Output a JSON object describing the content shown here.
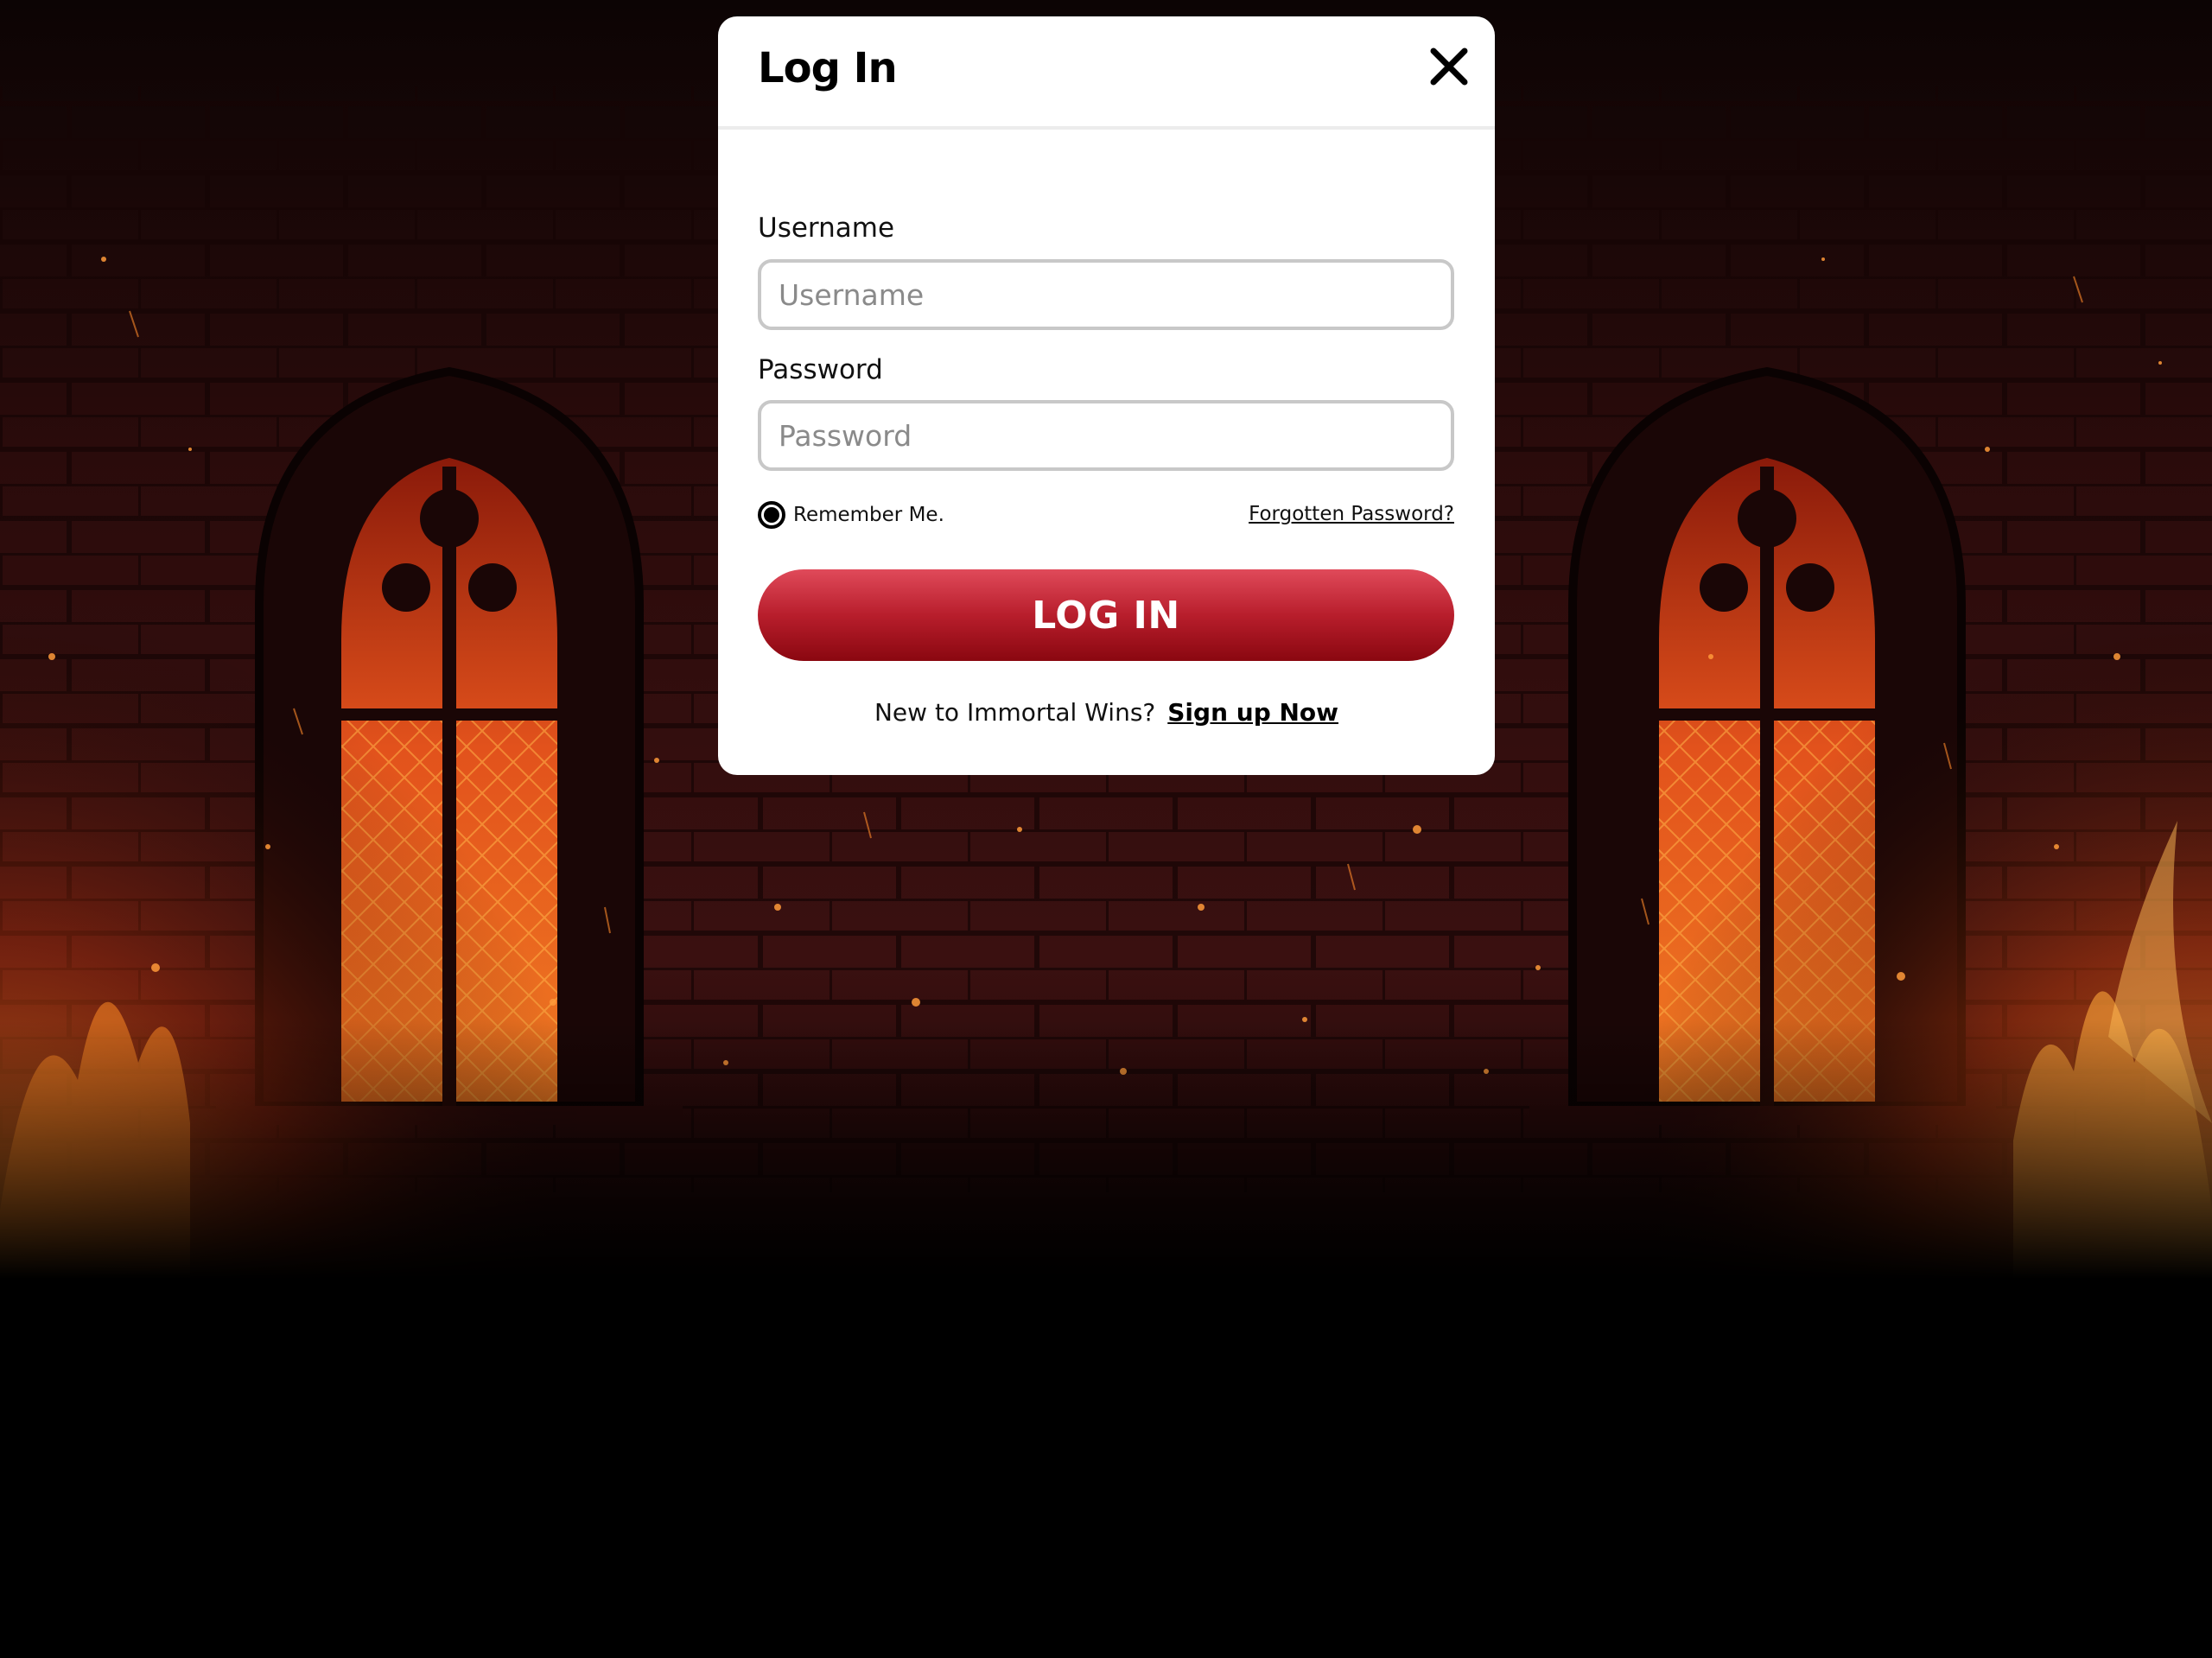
{
  "modal": {
    "title": "Log In"
  },
  "form": {
    "username_label": "Username",
    "username_placeholder": "Username",
    "username_value": "",
    "password_label": "Password",
    "password_placeholder": "Password",
    "password_value": "",
    "remember_label": "Remember Me.",
    "remember_checked": true,
    "forgot_label": "Forgotten Password?",
    "submit_label": "LOG IN"
  },
  "signup": {
    "prompt": "New to Immortal Wins?",
    "link_label": "Sign up Now"
  },
  "icons": {
    "close": "close-icon",
    "remember": "radio-selected-icon"
  },
  "colors": {
    "button_top": "#e04a5a",
    "button_bottom": "#8a0710",
    "backdrop": "#000000",
    "modal_bg": "#ffffff"
  }
}
